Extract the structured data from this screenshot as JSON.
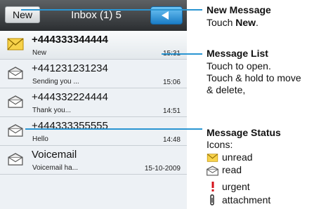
{
  "header": {
    "new_label": "New",
    "inbox_title": "Inbox (1) 5"
  },
  "messages": [
    {
      "from": "+444333344444",
      "preview": "New",
      "time": "15:31",
      "status": "unread"
    },
    {
      "from": "+441231231234",
      "preview": "Sending you ...",
      "time": "15:06",
      "status": "read"
    },
    {
      "from": "+444332224444",
      "preview": "Thank you...",
      "time": "14:51",
      "status": "read"
    },
    {
      "from": "+444333355555",
      "preview": "Hello",
      "time": "14:48",
      "status": "read"
    },
    {
      "from": "Voicemail",
      "preview": "Voicemail ha...",
      "time": "15-10-2009",
      "status": "read"
    }
  ],
  "callouts": {
    "new_message": {
      "title": "New Message",
      "text_prefix": "Touch ",
      "text_bold": "New",
      "text_suffix": "."
    },
    "message_list": {
      "title": "Message List",
      "line1": "Touch to open.",
      "line2": "Touch & hold to move",
      "line3": "& delete,"
    },
    "message_status": {
      "title": "Message Status",
      "icons_label": "Icons:",
      "unread": "unread",
      "read": "read",
      "urgent": "urgent",
      "attachment": "attachment"
    }
  },
  "colors": {
    "accent": "#2a95d2",
    "unread_envelope": "#f0b400",
    "urgent": "#d4101a"
  }
}
